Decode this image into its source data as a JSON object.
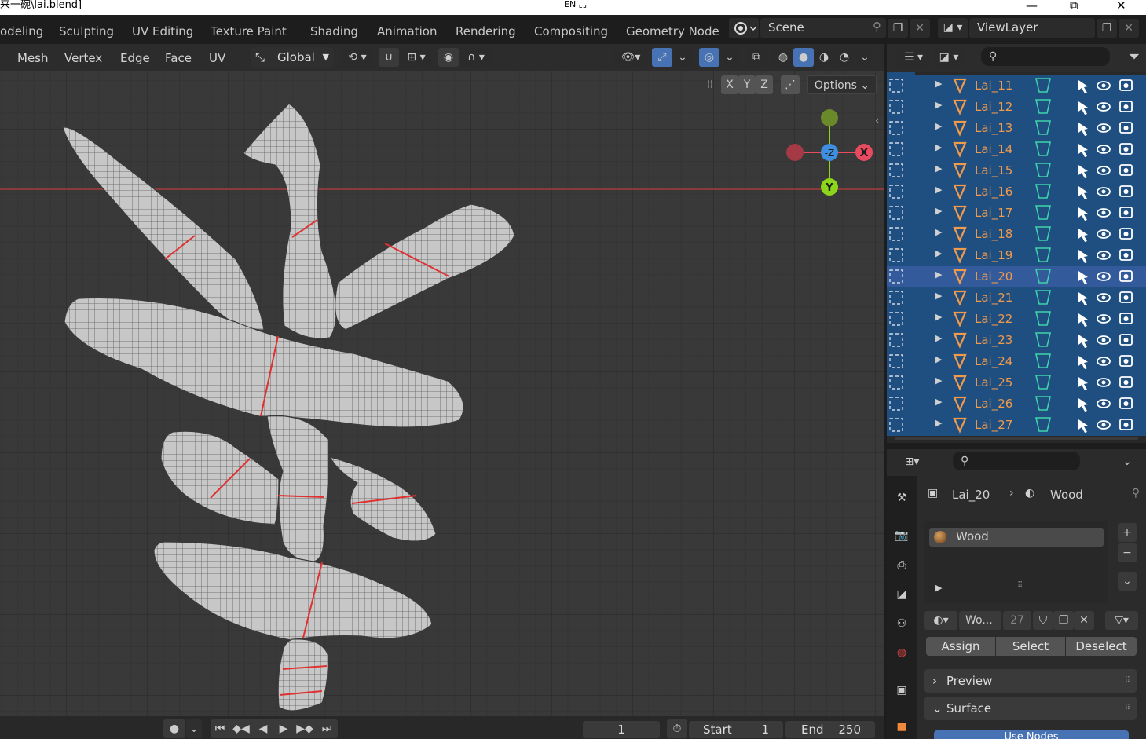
{
  "window": {
    "title": "来一碗\\lai.blend]",
    "ime": "EN",
    "minimize": "—",
    "restore": "⧉",
    "close": "✕"
  },
  "workspace_tabs": [
    "odeling",
    "Sculpting",
    "UV Editing",
    "Texture Paint",
    "Shading",
    "Animation",
    "Rendering",
    "Compositing",
    "Geometry Node"
  ],
  "scene": {
    "name": "Scene",
    "view_layer": "ViewLayer"
  },
  "viewport_menu": [
    "Mesh",
    "Vertex",
    "Edge",
    "Face",
    "UV"
  ],
  "transform_orientation": "Global",
  "axis_toggles": [
    "X",
    "Y",
    "Z"
  ],
  "options_label": "Options",
  "gizmo": {
    "x": "X",
    "y": "Y",
    "z": "-Z"
  },
  "outliner": {
    "rows": [
      "Lai_11",
      "Lai_12",
      "Lai_13",
      "Lai_14",
      "Lai_15",
      "Lai_16",
      "Lai_17",
      "Lai_18",
      "Lai_19",
      "Lai_20",
      "Lai_21",
      "Lai_22",
      "Lai_23",
      "Lai_24",
      "Lai_25",
      "Lai_26",
      "Lai_27"
    ],
    "active": "Lai_20"
  },
  "properties": {
    "object": "Lai_20",
    "material": "Wood",
    "slot": "Wood",
    "material_field": "Wo...",
    "users": "27",
    "assign": "Assign",
    "select": "Select",
    "deselect": "Deselect",
    "preview": "Preview",
    "surface": "Surface",
    "use_nodes": "Use Nodes"
  },
  "timeline": {
    "frame": "1",
    "start_label": "Start",
    "start": "1",
    "end_label": "End",
    "end": "250"
  },
  "colors": {
    "accent": "#4772b3",
    "outliner_row": "#1e4f80",
    "object_name": "#f29a4c",
    "seam": "#e03030",
    "axis_x": "#e84a5f",
    "axis_y": "#8bd51b",
    "axis_z": "#3f8ee0"
  }
}
